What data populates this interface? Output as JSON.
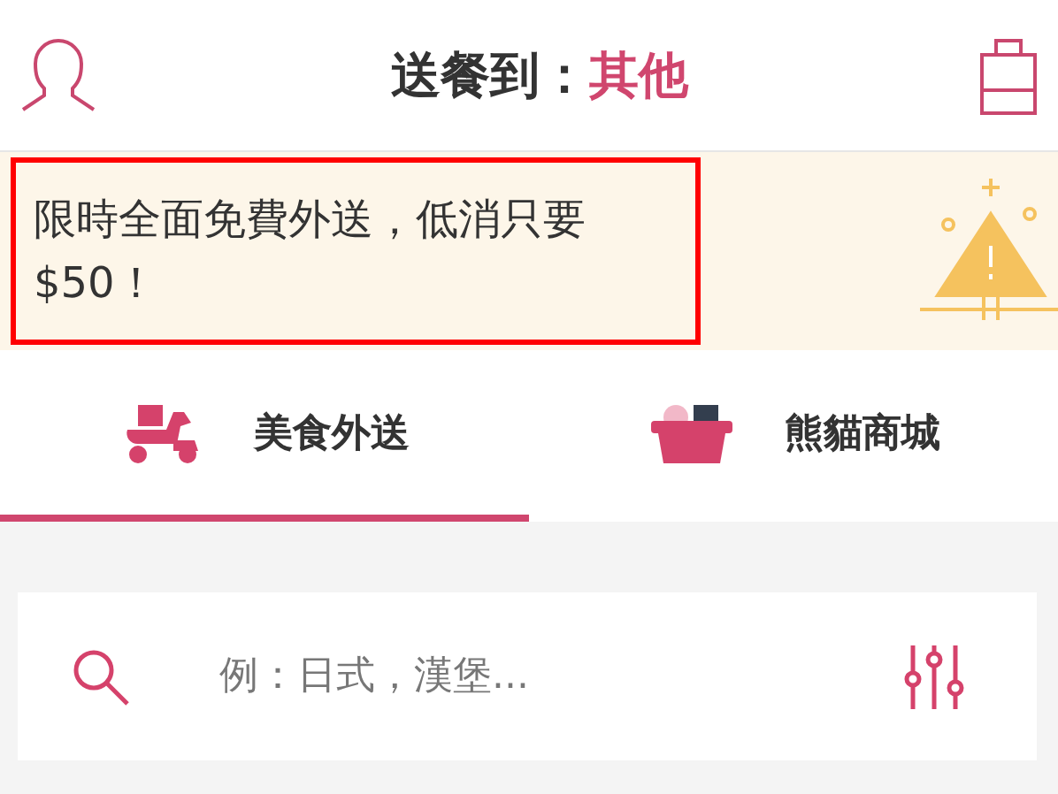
{
  "header": {
    "label": "送餐到：",
    "location": "其他"
  },
  "banner": {
    "text": "限時全面免費外送，低消只要 $50！",
    "highlighted": true
  },
  "tabs": [
    {
      "label": "美食外送",
      "kind": "scooter",
      "selected": true
    },
    {
      "label": "熊貓商城",
      "kind": "basket",
      "selected": false
    }
  ],
  "search": {
    "placeholder": "例：日式，漢堡..."
  }
}
